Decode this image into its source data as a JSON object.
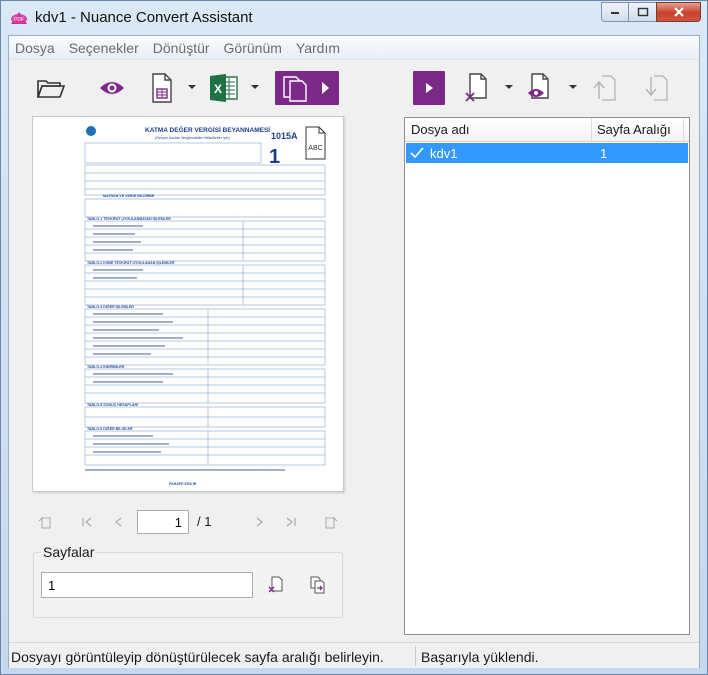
{
  "window": {
    "title": "kdv1 - Nuance Convert Assistant",
    "app_icon_text": "PDF"
  },
  "menu": {
    "items": [
      "Dosya",
      "Seçenekler",
      "Dönüştür",
      "Görünüm",
      "Yardım"
    ]
  },
  "toolbar": {
    "icons": [
      "open-folder-icon",
      "view-eye-icon",
      "document-calc-icon",
      "excel-icon",
      "pages-convert-icon",
      "run-icon",
      "remove-document-icon",
      "document-settings-icon",
      "move-up-icon",
      "move-down-icon"
    ],
    "excel_letter": "X"
  },
  "preview": {
    "form_title": "KATMA DEĞER VERGİSİ BEYANNAMESİ",
    "form_subtitle": "(Gerçek Usulde Vergilendirilen Mükellefler İçin)",
    "form_code": "1015A",
    "form_number": "1",
    "abc_label": "ABC",
    "sections": [
      "MATRAH VE VERGİ BİLDİRİMİ",
      "TABLO-1 TEVKİFAT UYGULANMAYAN İŞLEMLER",
      "TABLO-2 KISMİ TEVKİFAT UYGULANAN İŞLEMLER",
      "TABLO-3 DİĞER İŞLEMLER",
      "TABLO-4 İNDİRİMLER",
      "TABLO-5 SONUÇ HESAPLARI",
      "TABLO-6 DİĞER BİLGİLER"
    ],
    "footer": "PARAFE EDİLİR"
  },
  "navigation": {
    "current_page": "1",
    "total_pages": "/ 1"
  },
  "pages": {
    "label": "Sayfalar",
    "value": "1"
  },
  "file_table": {
    "columns": [
      "Dosya adı",
      "Sayfa Aralığı"
    ],
    "rows": [
      {
        "name": "kdv1",
        "range": "1",
        "checked": true
      }
    ]
  },
  "status": {
    "left": "Dosyayı görüntüleyip dönüştürülecek sayfa aralığı belirleyin.",
    "right": "Başarıyla yüklendi."
  },
  "colors": {
    "accent_purple": "#7b2a87",
    "selection_blue": "#3399ff",
    "excel_green": "#1f7244",
    "close_red": "#c7412b"
  }
}
